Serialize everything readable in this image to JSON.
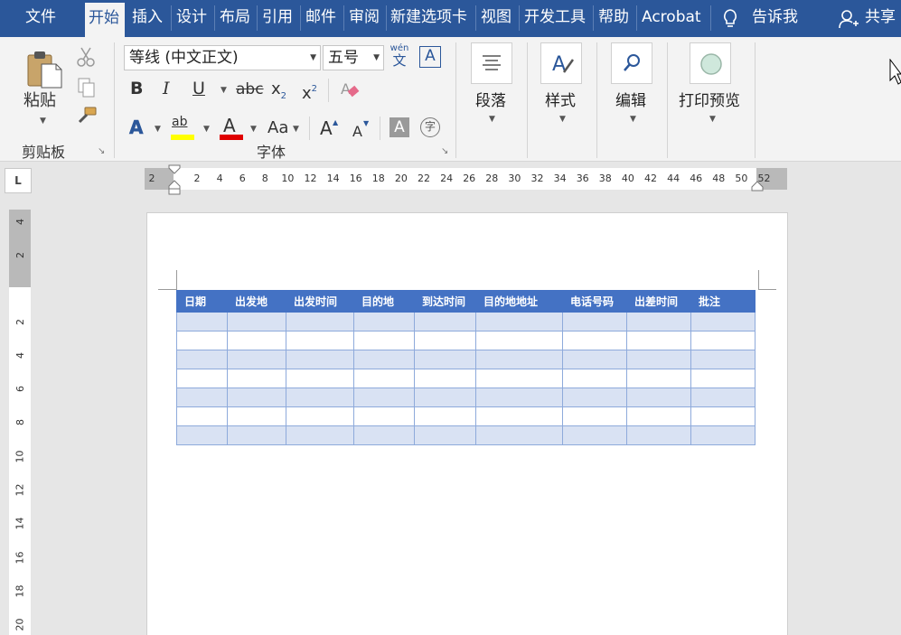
{
  "menu": {
    "tabs": [
      "文件",
      "开始",
      "插入",
      "设计",
      "布局",
      "引用",
      "邮件",
      "审阅",
      "新建选项卡",
      "视图",
      "开发工具",
      "帮助",
      "Acrobat"
    ],
    "active_tab": "开始",
    "tell_me": "告诉我",
    "share": "共享"
  },
  "ribbon": {
    "clipboard": {
      "paste_label": "粘贴",
      "group_label": "剪贴板"
    },
    "font": {
      "font_name": "等线 (中文正文)",
      "font_size": "五号",
      "phonetic_top": "wén",
      "phonetic_bottom": "文",
      "bold": "B",
      "italic": "I",
      "underline": "U",
      "strikethrough": "abc",
      "subscript": "x",
      "subscript_mark": "2",
      "superscript": "x",
      "superscript_mark": "2",
      "text_effects": "A",
      "highlight": "ab",
      "font_color": "A",
      "change_case": "Aa",
      "grow_font": "A",
      "shrink_font": "A",
      "char_shading": "A",
      "enclose_char": "字",
      "char_border": "A",
      "group_label": "字体"
    },
    "paragraph_label": "段落",
    "styles_label": "样式",
    "editing_label": "编辑",
    "print_preview_label": "打印预览"
  },
  "ruler": {
    "corner": "L",
    "horizontal_labels": [
      "2",
      "2",
      "4",
      "6",
      "8",
      "10",
      "12",
      "14",
      "16",
      "18",
      "20",
      "22",
      "24",
      "26",
      "28",
      "30",
      "32",
      "34",
      "36",
      "38",
      "40",
      "42",
      "44",
      "46",
      "48",
      "50",
      "52"
    ],
    "vertical_labels": [
      "4",
      "2",
      "2",
      "4",
      "6",
      "8",
      "10",
      "12",
      "14",
      "16",
      "18",
      "20"
    ]
  },
  "table": {
    "headers": [
      "日期",
      "出发地",
      "出发时间",
      "目的地",
      "到达时间",
      "目的地地址",
      "电话号码",
      "出差时间",
      "批注"
    ],
    "row_count": 7
  },
  "colors": {
    "menu_bar": "#2b579a",
    "table_header": "#4472c4",
    "table_band": "#d9e2f3",
    "highlight_yellow": "#ffff00",
    "font_red": "#e00000"
  }
}
